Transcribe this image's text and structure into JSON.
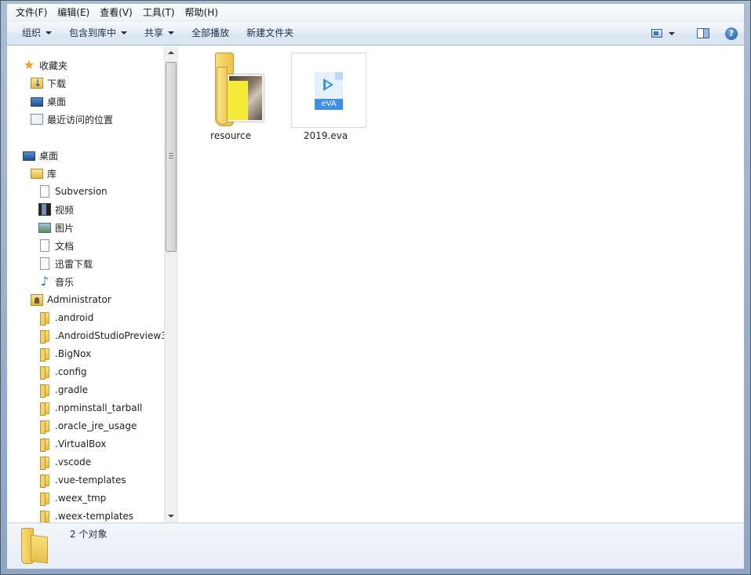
{
  "menu": [
    {
      "label": "文件(F)"
    },
    {
      "label": "编辑(E)"
    },
    {
      "label": "查看(V)"
    },
    {
      "label": "工具(T)"
    },
    {
      "label": "帮助(H)"
    }
  ],
  "toolbar": {
    "organize": "组织",
    "include_library": "包含到库中",
    "share": "共享",
    "play_all": "全部播放",
    "new_folder": "新建文件夹",
    "help_glyph": "?"
  },
  "nav": {
    "favorites": "收藏夹",
    "favorites_items": [
      "下载",
      "桌面",
      "最近访问的位置"
    ],
    "desktop": "桌面",
    "library": "库",
    "library_items": [
      "Subversion",
      "视频",
      "图片",
      "文档",
      "迅雷下载",
      "音乐"
    ],
    "user": "Administrator",
    "user_folders": [
      ".android",
      ".AndroidStudioPreview3",
      ".BigNox",
      ".config",
      ".gradle",
      ".npminstall_tarball",
      ".oracle_jre_usage",
      ".VirtualBox",
      ".vscode",
      ".vue-templates",
      ".weex_tmp",
      ".weex-templates"
    ]
  },
  "files": [
    {
      "name": "resource",
      "type": "folder"
    },
    {
      "name": "2019.eva",
      "type": "eva",
      "badge": "eVA"
    }
  ],
  "status": {
    "count_text": "2 个对象"
  },
  "colors": {
    "accent": "#3e8fe8",
    "folder": "#ecc14a"
  }
}
